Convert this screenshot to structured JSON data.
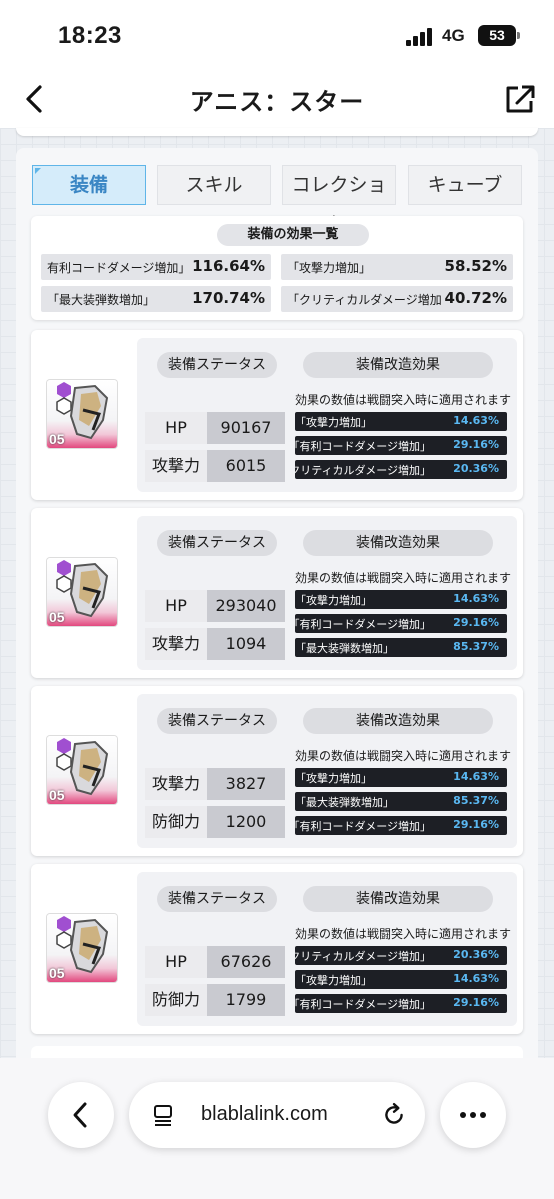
{
  "status": {
    "time": "18:23",
    "network": "4G",
    "battery": "53"
  },
  "nav": {
    "title": "アニス：スター"
  },
  "tabs": [
    {
      "label": "装備",
      "active": true
    },
    {
      "label": "スキル",
      "active": false
    },
    {
      "label": "コレクション",
      "active": false
    },
    {
      "label": "キューブ",
      "active": false
    }
  ],
  "summary": {
    "title": "装備の効果一覧",
    "items": [
      {
        "label": "有利コードダメージ増加」",
        "value": "116.64%"
      },
      {
        "label": "「攻撃力増加」",
        "value": "58.52%"
      },
      {
        "label": "「最大装弾数増加」",
        "value": "170.74%"
      },
      {
        "label": "クリティカルダメージ増加」",
        "value": "40.72%"
      }
    ]
  },
  "labels": {
    "stat_header": "装備ステータス",
    "effect_header": "装備改造効果",
    "note": "効果の数値は戦闘突入時に適用されます"
  },
  "cards": [
    {
      "level": "05",
      "stats": [
        {
          "label": "HP",
          "value": "90167"
        },
        {
          "label": "攻撃力",
          "value": "6015"
        }
      ],
      "effects": [
        {
          "label": "「攻撃力増加」",
          "value": "14.63%"
        },
        {
          "label": "「有利コードダメージ増加」",
          "value": "29.16%"
        },
        {
          "label": "「クリティカルダメージ増加」",
          "value": "20.36%"
        }
      ]
    },
    {
      "level": "05",
      "stats": [
        {
          "label": "HP",
          "value": "293040"
        },
        {
          "label": "攻撃力",
          "value": "1094"
        }
      ],
      "effects": [
        {
          "label": "「攻撃力増加」",
          "value": "14.63%"
        },
        {
          "label": "「有利コードダメージ増加」",
          "value": "29.16%"
        },
        {
          "label": "「最大装弾数増加」",
          "value": "85.37%"
        }
      ]
    },
    {
      "level": "05",
      "stats": [
        {
          "label": "攻撃力",
          "value": "3827"
        },
        {
          "label": "防御力",
          "value": "1200"
        }
      ],
      "effects": [
        {
          "label": "「攻撃力増加」",
          "value": "14.63%"
        },
        {
          "label": "「最大装弾数増加」",
          "value": "85.37%"
        },
        {
          "label": "「有利コードダメージ増加」",
          "value": "29.16%"
        }
      ]
    },
    {
      "level": "05",
      "stats": [
        {
          "label": "HP",
          "value": "67626"
        },
        {
          "label": "防御力",
          "value": "1799"
        }
      ],
      "effects": [
        {
          "label": "「クリティカルダメージ増加」",
          "value": "20.36%"
        },
        {
          "label": "「攻撃力増加」",
          "value": "14.63%"
        },
        {
          "label": "「有利コードダメージ増加」",
          "value": "29.16%"
        }
      ]
    }
  ],
  "browser": {
    "url": "blablalink.com"
  },
  "colors": {
    "accent": "#5fb5e8",
    "effect_value": "#5ab8f2",
    "card_pink": "#e2487e"
  }
}
